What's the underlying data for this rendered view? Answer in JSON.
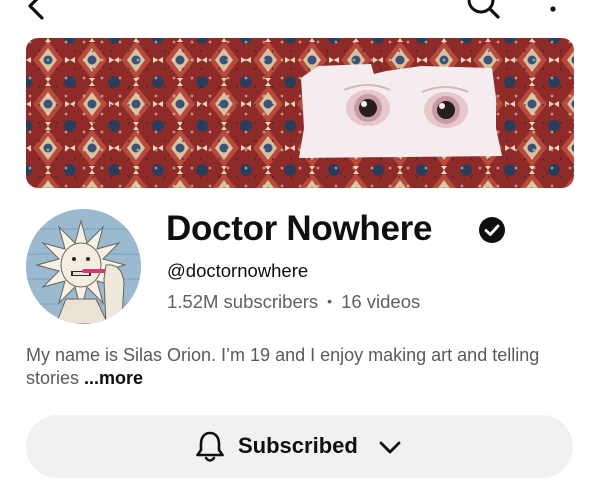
{
  "channel": {
    "name": "Doctor Nowhere",
    "handle": "@doctornowhere",
    "subscribers": "1.52M subscribers",
    "separator": "•",
    "videos": "16 videos",
    "description": "My name is Silas Orion. I’m 19 and I enjoy making art and telling stories",
    "more_label": "...more"
  },
  "subscribe_button": {
    "label": "Subscribed"
  },
  "icons": {
    "back": "chevron-left-icon",
    "search": "search-icon",
    "more": "more-vertical-icon",
    "verified": "verified-check-icon",
    "bell": "bell-icon",
    "dropdown": "chevron-down-icon"
  },
  "colors": {
    "banner_rug": "#8e2a28",
    "subscribe_bg": "#f1f1f1",
    "secondary_text": "#606060"
  }
}
